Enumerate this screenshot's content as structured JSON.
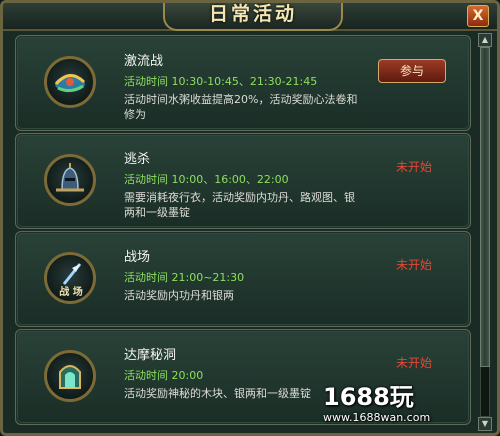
{
  "window": {
    "title": "日常活动",
    "close_label": "X"
  },
  "activities": [
    {
      "name": "激流战",
      "time": "活动时间 10:30-10:45、21:30-21:45",
      "desc": "活动时间水粥收益提高20%，活动奖励心法卷和修为",
      "action": {
        "type": "button",
        "label": "参与"
      },
      "icon": "swirl-battle-icon"
    },
    {
      "name": "逃杀",
      "time": "活动时间 10:00、16:00、22:00",
      "desc": "需要消耗夜行衣，活动奖励内功丹、路观图、银两和一级墨锭",
      "action": {
        "type": "status",
        "label": "未开始"
      },
      "icon": "knight-helmet-icon"
    },
    {
      "name": "战场",
      "time": "活动时间 21:00~21:30",
      "desc": "活动奖励内功丹和银两",
      "action": {
        "type": "status",
        "label": "未开始"
      },
      "icon": "battlefield-spear-icon",
      "icon_text": "战 场"
    },
    {
      "name": "达摩秘洞",
      "time": "活动时间 20:00",
      "desc": "活动奖励神秘的木块、银两和一级墨锭",
      "action": {
        "type": "status",
        "label": "未开始"
      },
      "icon": "cave-gate-icon"
    }
  ],
  "watermark": {
    "logo": "1688玩",
    "url": "www.1688wan.com"
  },
  "colors": {
    "status": "#e34835",
    "time": "#8be05e",
    "frame": "#6b6440"
  }
}
